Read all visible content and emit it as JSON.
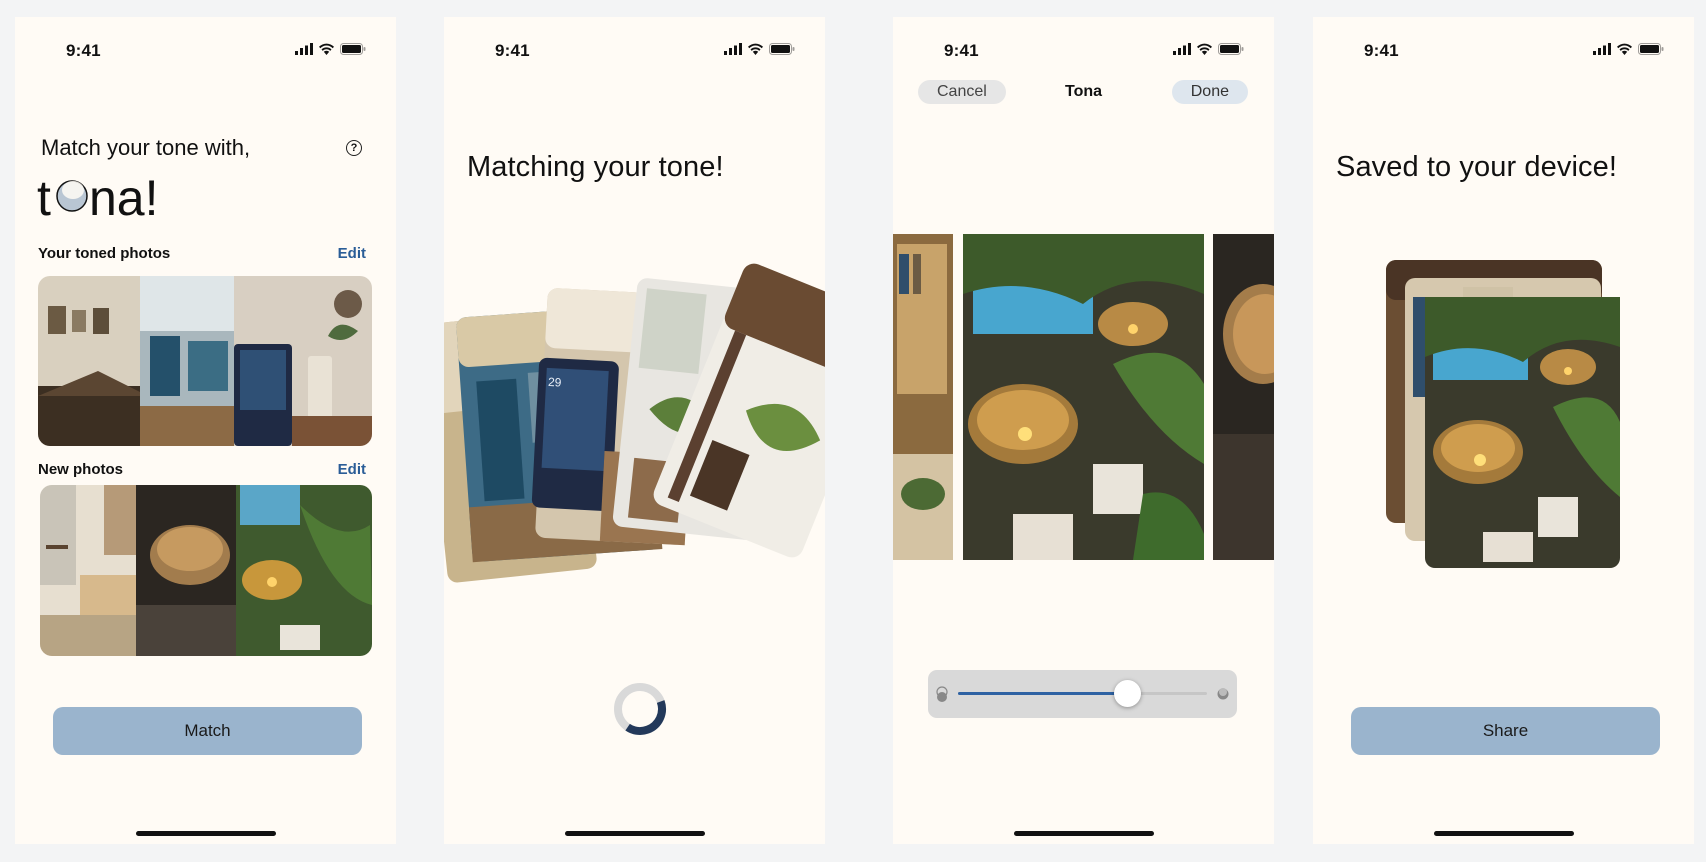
{
  "status_bar": {
    "time": "9:41",
    "icons": [
      "cellular-signal-icon",
      "wifi-icon",
      "battery-icon"
    ]
  },
  "screen_match": {
    "title": "Match your tone with,",
    "logo_text": "tona!",
    "help_icon": "question-circle-icon",
    "toned_section": {
      "label": "Your toned photos",
      "edit": "Edit"
    },
    "new_section": {
      "label": "New photos",
      "edit": "Edit"
    },
    "button": "Match"
  },
  "screen_matching": {
    "title": "Matching your tone!",
    "progress_fraction": 0.4,
    "photo_date_label": "29"
  },
  "screen_editor": {
    "cancel": "Cancel",
    "title": "Tona",
    "done": "Done",
    "slider_fraction": 0.68
  },
  "screen_saved": {
    "title": "Saved to your device!",
    "button": "Share"
  },
  "colors": {
    "accent_button": "#9ab4cd",
    "edit_link": "#2a5d97",
    "slider_fill": "#2e62a3",
    "screen_bg": "#fffbf5"
  }
}
